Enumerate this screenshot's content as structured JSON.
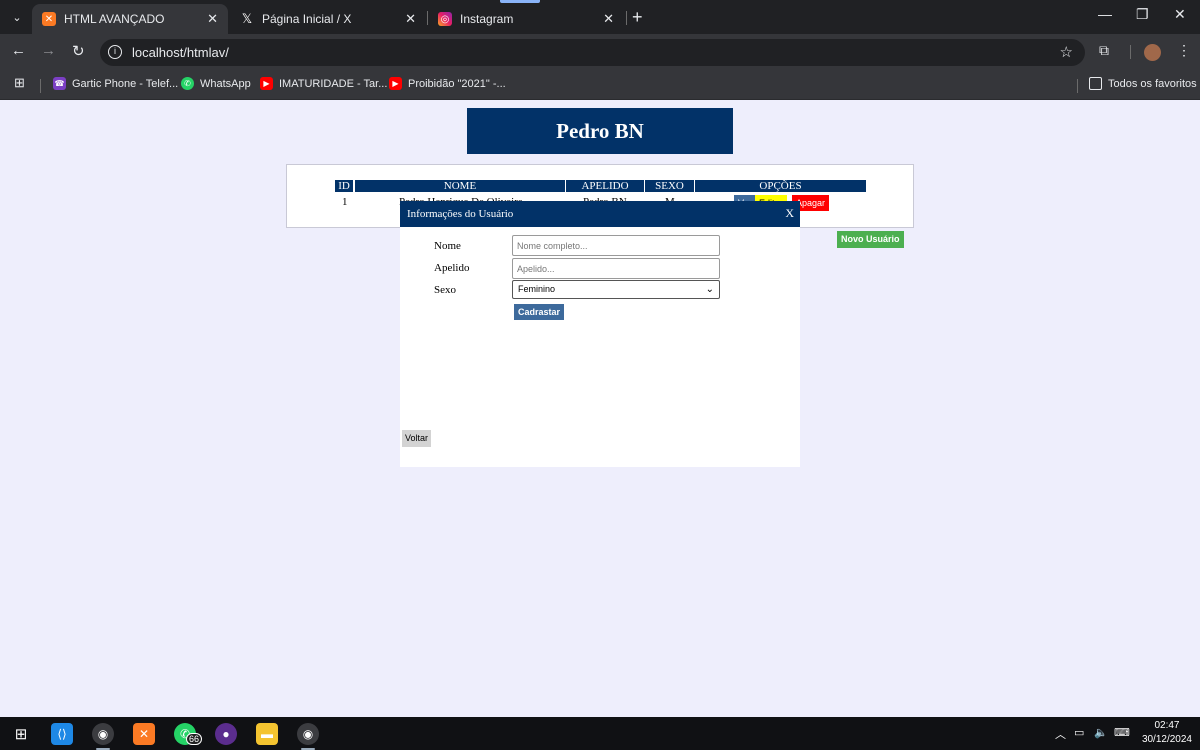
{
  "browser": {
    "tabs": [
      {
        "title": "HTML AVANÇADO",
        "active": true
      },
      {
        "title": "Página Inicial / X",
        "active": false
      },
      {
        "title": "Instagram",
        "active": false
      }
    ],
    "url": "localhost/htmlav/",
    "bookmarks": [
      "Gartic Phone - Telef...",
      "WhatsApp",
      "IMATURIDADE - Tar...",
      "Proibidão \"2021\" -..."
    ],
    "favorites_label": "Todos os favoritos"
  },
  "page": {
    "header": "Pedro BN",
    "table": {
      "columns": [
        "ID",
        "NOME",
        "APELIDO",
        "SEXO",
        "OPÇÕES"
      ],
      "rows": [
        {
          "id": "1",
          "nome": "Pedro Henrique De Oliveira",
          "apelido": "Pedro BN",
          "sexo": "M"
        }
      ],
      "actions": [
        "Ver",
        "Editar",
        "Apagar"
      ]
    },
    "novo_usuario": "Novo Usuário"
  },
  "modal": {
    "title": "Informações do Usuário",
    "close": "X",
    "labels": {
      "nome": "Nome",
      "apelido": "Apelido",
      "sexo": "Sexo"
    },
    "placeholders": {
      "nome": "Nome completo...",
      "apelido": "Apelido..."
    },
    "sexo_selected": "Feminino",
    "submit": "Cadrastar",
    "back": "Voltar"
  },
  "taskbar": {
    "whatsapp_badge": "66",
    "time": "02:47",
    "date": "30/12/2024"
  },
  "colors": {
    "header_bg": "#023268",
    "page_bg": "#eeeefc",
    "novo_btn": "#4caf50",
    "apagar_btn": "#ff0000",
    "editar_btn": "#ffff00"
  }
}
